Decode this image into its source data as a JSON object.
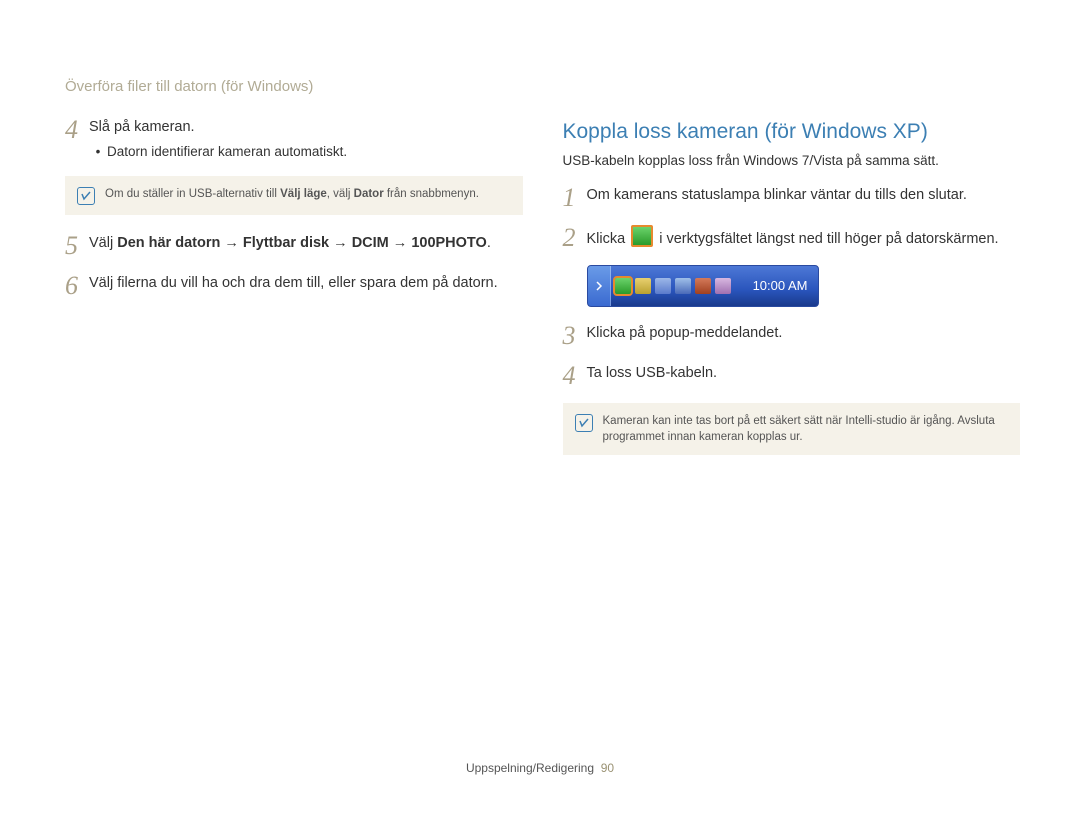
{
  "breadcrumb": "Överföra filer till datorn (för Windows)",
  "left": {
    "steps": [
      {
        "num": "4",
        "text": "Slå på kameran.",
        "bullet": "Datorn identifierar kameran automatiskt.",
        "note": {
          "pre": "Om du ställer in USB-alternativ till ",
          "b1": "Välj läge",
          "mid": ", välj ",
          "b2": "Dator",
          "post": " från snabbmenyn."
        }
      },
      {
        "num": "5",
        "pre": "Välj ",
        "b1": "Den här datorn",
        "arrow1": " → ",
        "b2": "Flyttbar disk",
        "arrow2": " → ",
        "b3": "DCIM",
        "arrow3": " → ",
        "b4": "100PHOTO",
        "post": "."
      },
      {
        "num": "6",
        "text": "Välj filerna du vill ha och dra dem till, eller spara dem på datorn."
      }
    ]
  },
  "right": {
    "heading": "Koppla loss kameran (för Windows XP)",
    "subnote": "USB-kabeln kopplas loss från Windows 7/Vista på samma sätt.",
    "steps": [
      {
        "num": "1",
        "text": "Om kamerans statuslampa blinkar väntar du tills den slutar."
      },
      {
        "num": "2",
        "pre": "Klicka ",
        "post": " i verktygsfältet längst ned till höger på datorskärmen."
      },
      {
        "num": "3",
        "text": "Klicka på popup-meddelandet."
      },
      {
        "num": "4",
        "text": "Ta loss USB-kabeln."
      }
    ],
    "tray_time": "10:00 AM",
    "note": "Kameran kan inte tas bort på ett säkert sätt när Intelli-studio är igång. Avsluta programmet innan kameran kopplas ur."
  },
  "footer": {
    "section": "Uppspelning/Redigering",
    "page": "90"
  }
}
